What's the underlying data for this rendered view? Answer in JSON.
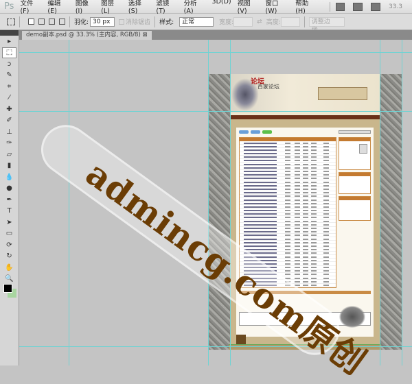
{
  "app": {
    "logo": "Ps"
  },
  "menu": [
    "文件(F)",
    "编辑(E)",
    "图像(I)",
    "图层(L)",
    "选择(S)",
    "滤镜(T)",
    "分析(A)",
    "3D(D)",
    "视图(V)",
    "窗口(W)",
    "帮助(H)"
  ],
  "appbar": {
    "bridge": "Br",
    "minibridge": "Mb",
    "zoom": "33.3"
  },
  "options": {
    "feather_label": "羽化:",
    "feather_value": "30 px",
    "antialias": "消除锯齿",
    "style_label": "样式:",
    "style_value": "正常",
    "width_label": "宽度:",
    "height_label": "高度:",
    "refine_edge": "调整边缘..."
  },
  "document": {
    "tab_title": "demo副本.psd @ 33.3% (主内容, RGB/8)",
    "logo_line1": "论坛",
    "logo_line2": "百家论坛"
  },
  "tools": [
    "move",
    "marquee",
    "lasso",
    "quick-select",
    "crop",
    "eyedropper",
    "healing",
    "brush",
    "stamp",
    "history-brush",
    "eraser",
    "gradient",
    "blur",
    "dodge",
    "pen",
    "type",
    "path-select",
    "shape",
    "3d-rotate",
    "3d-orbit",
    "hand",
    "zoom"
  ],
  "colors": {
    "foreground": "#000000",
    "background": "#a8d5a0",
    "guide": "#6fd3d3"
  },
  "watermark": "admincg.com原创"
}
